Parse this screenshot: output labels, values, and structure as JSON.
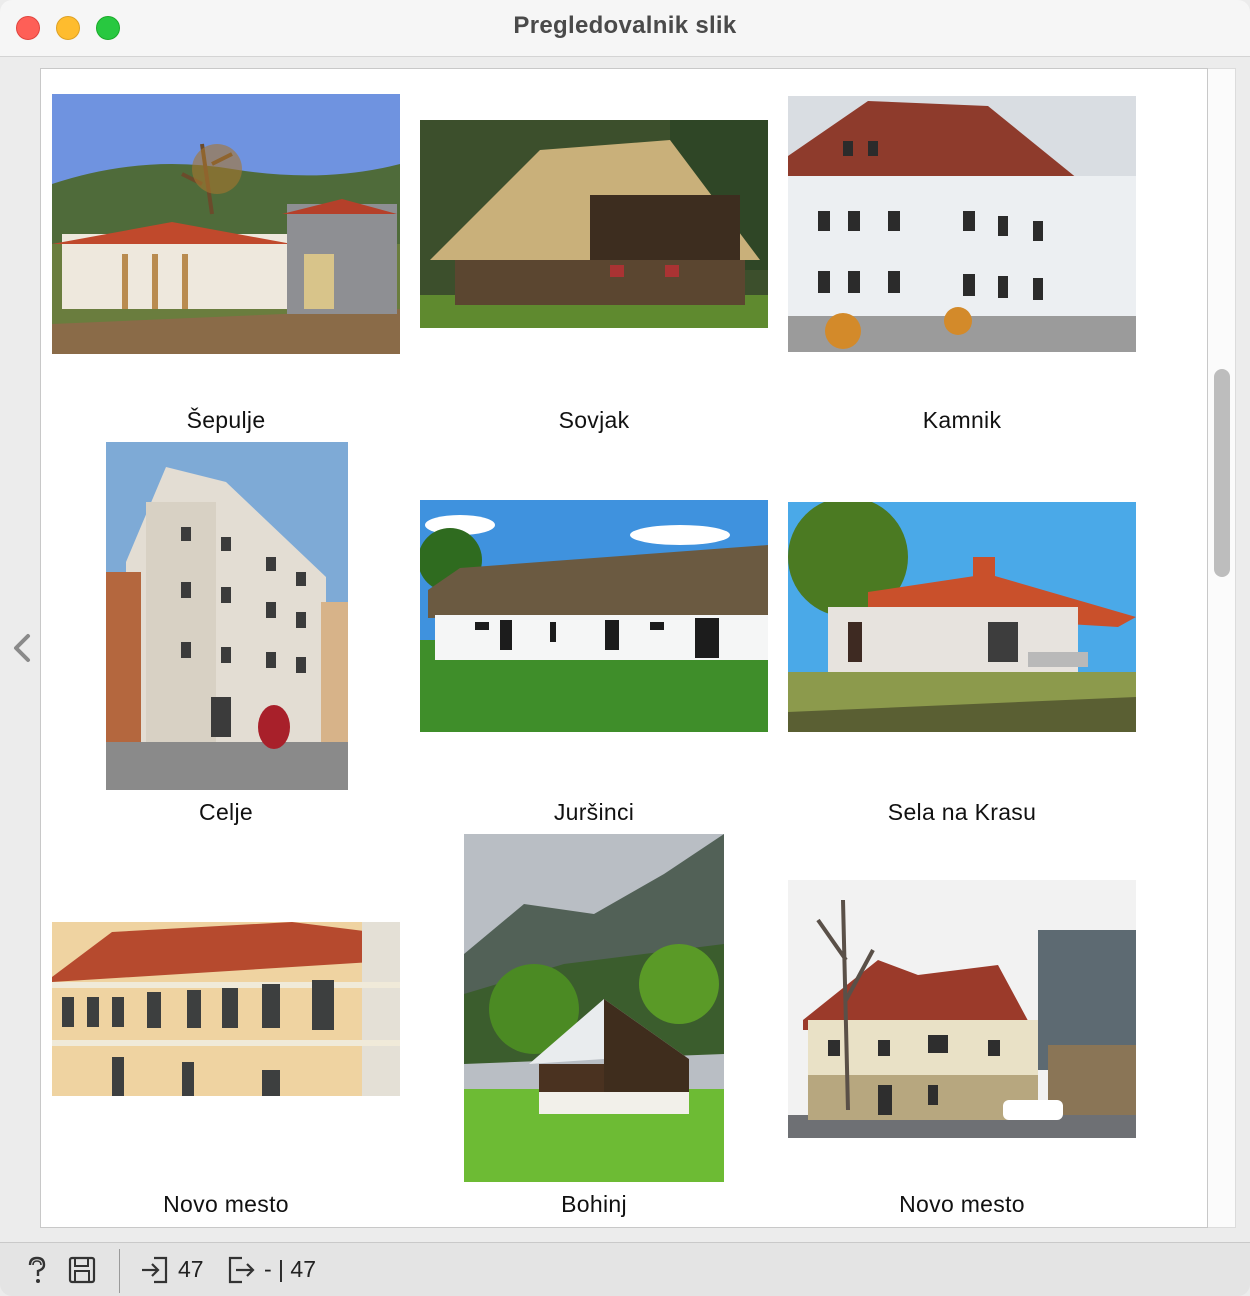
{
  "window": {
    "title": "Pregledovalnik slik"
  },
  "navigation": {
    "back_icon": "chevron-left-icon"
  },
  "gallery": {
    "items": [
      {
        "caption": "Šepulje"
      },
      {
        "caption": "Sovjak"
      },
      {
        "caption": "Kamnik"
      },
      {
        "caption": "Celje"
      },
      {
        "caption": "Juršinci"
      },
      {
        "caption": "Sela na Krasu"
      },
      {
        "caption": "Novo mesto"
      },
      {
        "caption": "Bohinj"
      },
      {
        "caption": "Novo mesto"
      }
    ]
  },
  "statusbar": {
    "help_icon": "help-icon",
    "save_icon": "save-icon",
    "input_icon": "input-icon",
    "input_count": "47",
    "output_icon": "output-icon",
    "output_count": "- | 47"
  },
  "colors": {
    "close": "#fe5f57",
    "minimize": "#febc2e",
    "maximize": "#28c840"
  }
}
